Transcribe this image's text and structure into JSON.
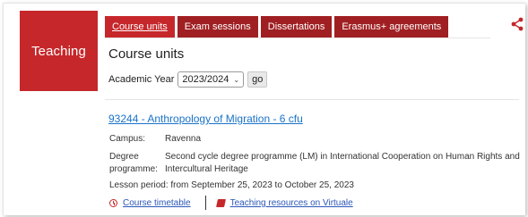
{
  "side": {
    "title": "Teaching"
  },
  "tabs": [
    {
      "label": "Course units"
    },
    {
      "label": "Exam sessions"
    },
    {
      "label": "Dissertations"
    },
    {
      "label": "Erasmus+ agreements"
    }
  ],
  "page": {
    "heading": "Course units"
  },
  "year_filter": {
    "label": "Academic Year",
    "selected": "2023/2024",
    "go_label": "go"
  },
  "course": {
    "title": "93244 - Anthropology of Migration - 6 cfu",
    "campus_label": "Campus:",
    "campus_value": "Ravenna",
    "degree_label_1": "Degree",
    "degree_label_2": "programme:",
    "degree_value_1": "Second cycle degree programme (LM) in International Cooperation on Human Rights and",
    "degree_value_2": "Intercultural Heritage",
    "lesson_period": "Lesson period: from September 25, 2023 to October 25, 2023"
  },
  "links": {
    "timetable": "Course timetable",
    "resources": "Teaching resources on Virtuale"
  },
  "colors": {
    "brand_red": "#c6272b",
    "tab_dark_red": "#a01f22",
    "link_blue": "#1a73c8"
  },
  "icons": {
    "share": "share-icon",
    "clock": "clock-icon",
    "book": "book-icon"
  }
}
